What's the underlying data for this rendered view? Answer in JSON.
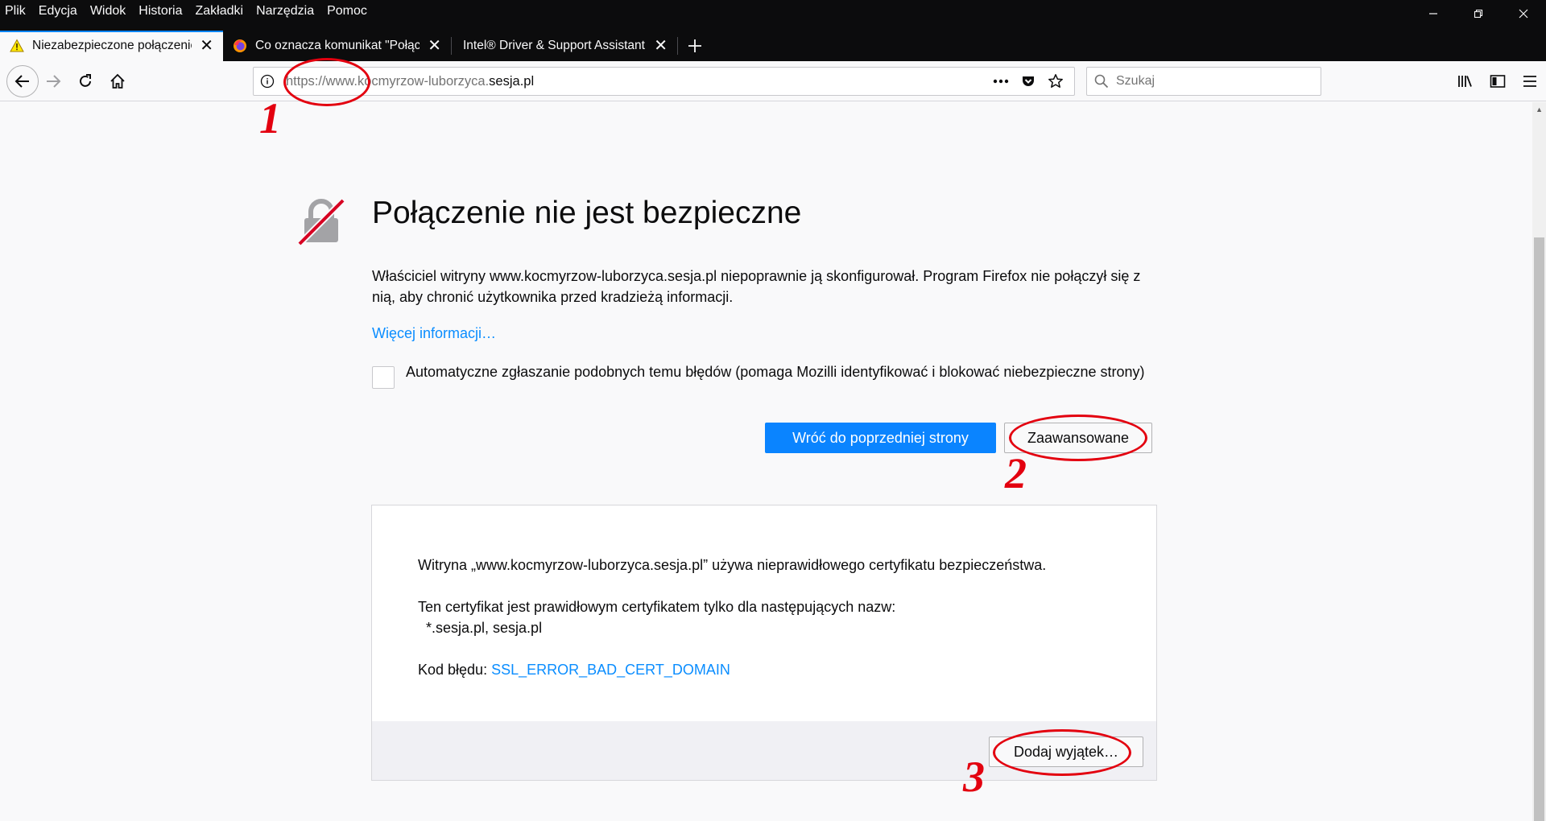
{
  "menubar": {
    "items": [
      {
        "label": "Plik"
      },
      {
        "label": "Edycja"
      },
      {
        "label": "Widok"
      },
      {
        "label": "Historia"
      },
      {
        "label": "Zakładki"
      },
      {
        "label": "Narzędzia"
      },
      {
        "label": "Pomoc"
      }
    ]
  },
  "tabs": [
    {
      "title": "Niezabezpieczone połączenie",
      "icon": "warning-icon",
      "active": true
    },
    {
      "title": "Co oznacza komunikat \"Połącze",
      "icon": "firefox-icon",
      "active": false
    },
    {
      "title": "Intel® Driver & Support Assistant",
      "icon": "",
      "active": false
    }
  ],
  "urlbar": {
    "scheme": "https://www.",
    "subdomain": "kocmyrzow-luborzyca.",
    "host": "sesja.pl"
  },
  "search": {
    "placeholder": "Szukaj"
  },
  "page": {
    "title": "Połączenie nie jest bezpieczne",
    "description": "Właściciel witryny www.kocmyrzow-luborzyca.sesja.pl niepoprawnie ją skonfigurował. Program Firefox nie połączył się z nią, aby chronić użytkownika przed kradzieżą informacji.",
    "learn_more": "Więcej informacji…",
    "report_label": "Automatyczne zgłaszanie podobnych temu błędów (pomaga Mozilli identyfikować i blokować niebezpieczne strony)",
    "report_checked": false,
    "back_button": "Wróć do poprzedniej strony",
    "advanced_button": "Zaawansowane"
  },
  "advanced": {
    "line1": "Witryna „www.kocmyrzow-luborzyca.sesja.pl” używa nieprawidłowego certyfikatu bezpieczeństwa.",
    "line2": "Ten certyfikat jest prawidłowym certyfikatem tylko dla następujących nazw:",
    "names": "*.sesja.pl, sesja.pl",
    "error_label": "Kod błędu:",
    "error_code": "SSL_ERROR_BAD_CERT_DOMAIN",
    "exception_button": "Dodaj wyjątek…"
  },
  "annotations": {
    "n1": "1",
    "n2": "2",
    "n3": "3",
    "color": "#e3000f"
  },
  "colors": {
    "accent": "#0a84ff",
    "link": "#0a8dff",
    "chrome_dark": "#0c0c0d"
  }
}
